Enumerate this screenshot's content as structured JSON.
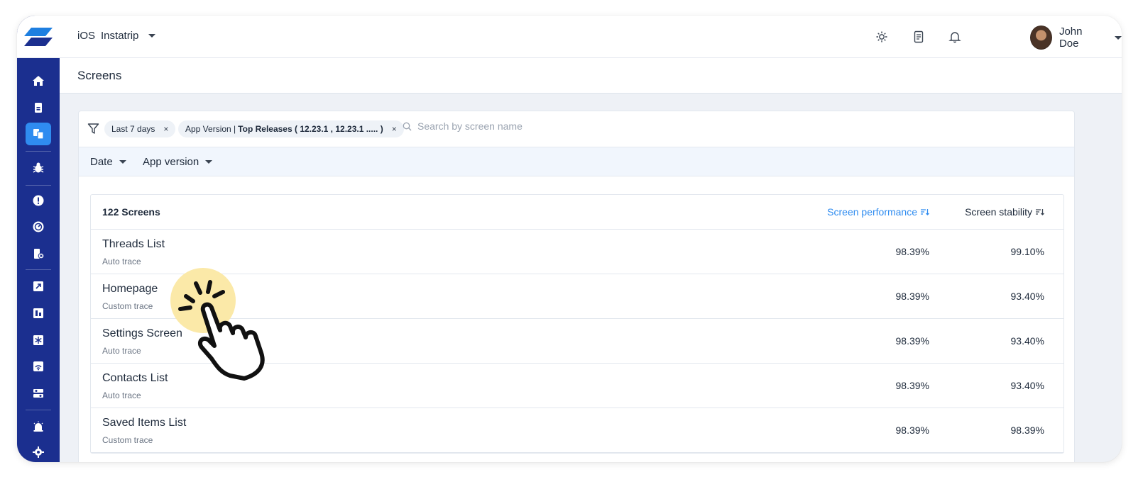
{
  "header": {
    "platform": "iOS",
    "app_name": "Instatrip",
    "user_name": "John Doe"
  },
  "sidebar": {
    "items": [
      {
        "icon": "home-icon"
      },
      {
        "icon": "document-icon"
      },
      {
        "icon": "screens-icon",
        "active": true
      },
      {
        "icon": "bug-icon"
      },
      {
        "icon": "alert-icon"
      },
      {
        "icon": "speedometer-icon"
      },
      {
        "icon": "crash-icon"
      },
      {
        "icon": "release-icon"
      },
      {
        "icon": "dashboard-icon"
      },
      {
        "icon": "snowflake-icon"
      },
      {
        "icon": "network-icon"
      },
      {
        "icon": "settings-slider-icon"
      },
      {
        "icon": "alarm-icon"
      },
      {
        "icon": "gear-icon"
      }
    ]
  },
  "page": {
    "title": "Screens"
  },
  "filters": {
    "chips": [
      {
        "label": "Last 7 days",
        "remove": "×"
      },
      {
        "prefix": "App Version | ",
        "value": "Top Releases ( 12.23.1 , 12.23.1 ..... )",
        "remove": "×"
      }
    ],
    "search_placeholder": "Search by screen name",
    "dropdowns": [
      "Date",
      "App version"
    ]
  },
  "table": {
    "count_label": "122 Screens",
    "columns": {
      "performance": "Screen performance",
      "stability": "Screen stability"
    },
    "rows": [
      {
        "name": "Threads List",
        "type": "Auto trace",
        "performance": "98.39%",
        "stability": "99.10%"
      },
      {
        "name": "Homepage",
        "type": "Custom trace",
        "performance": "98.39%",
        "stability": "93.40%"
      },
      {
        "name": "Settings Screen",
        "type": "Auto trace",
        "performance": "98.39%",
        "stability": "93.40%"
      },
      {
        "name": "Contacts List",
        "type": "Auto trace",
        "performance": "98.39%",
        "stability": "93.40%"
      },
      {
        "name": "Saved Items List",
        "type": "Custom trace",
        "performance": "98.39%",
        "stability": "98.39%"
      }
    ]
  },
  "colors": {
    "sidebar": "#1b2f8f",
    "accent": "#2f8cf0",
    "highlight": "#fbe9a8"
  }
}
